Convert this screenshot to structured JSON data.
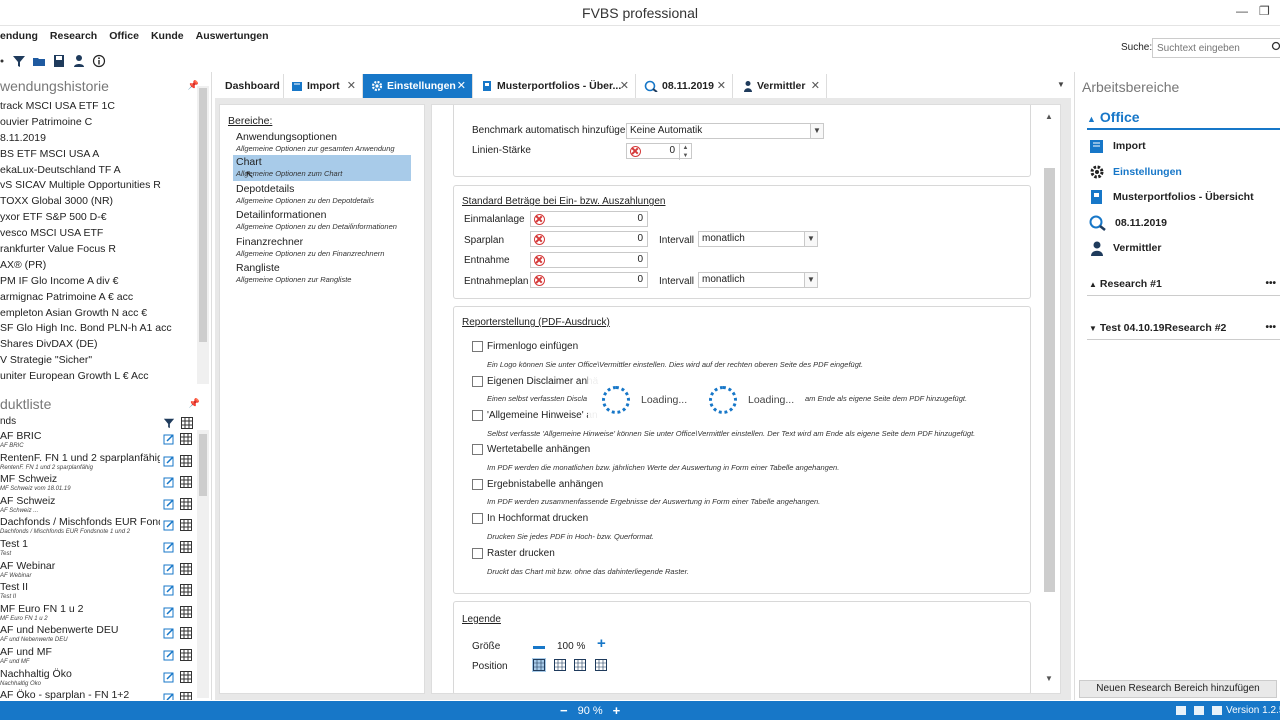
{
  "window": {
    "title": "FVBS professional"
  },
  "menu": [
    "endung",
    "Research",
    "Office",
    "Kunde",
    "Auswertungen"
  ],
  "search": {
    "label": "Suche:",
    "placeholder": "Suchtext eingeben"
  },
  "left": {
    "history_title": "wendungshistorie",
    "history": [
      "track MSCI USA ETF 1C",
      "ouvier Patrimoine C",
      "8.11.2019",
      "BS ETF MSCI USA A",
      "ekaLux-Deutschland TF A",
      "vS SICAV Multiple Opportunities R",
      "TOXX Global 3000 (NR)",
      "yxor ETF S&P 500 D-€",
      "vesco MSCI USA ETF",
      "rankfurter Value Focus R",
      "AX® (PR)",
      "PM IF Glo Income A div €",
      "armignac Patrimoine A € acc",
      "empleton Asian Growth N acc €",
      "SF Glo High Inc. Bond PLN-h A1 acc",
      "Shares DivDAX (DE)",
      "V Strategie \"Sicher\"",
      "uniter European Growth L € Acc"
    ],
    "products_title": "duktliste",
    "products_group": "nds",
    "products": [
      {
        "name": "AF BRIC",
        "sub": "AF BRIC"
      },
      {
        "name": "RentenF. FN 1 und 2 sparplanfähig",
        "sub": "RentenF. FN 1 und 2 sparplanfähig"
      },
      {
        "name": "MF Schweiz",
        "sub": "MF Schweiz vom 18.01.19"
      },
      {
        "name": "AF Schweiz",
        "sub": "AF Schweiz ..."
      },
      {
        "name": "Dachfonds / Mischfonds EUR Fondsn",
        "sub": "Dachfonds / Mischfonds EUR Fondsnote 1 und 2"
      },
      {
        "name": "Test 1",
        "sub": "Test"
      },
      {
        "name": "AF Webinar",
        "sub": "AF Webinar"
      },
      {
        "name": "Test II",
        "sub": "Test II"
      },
      {
        "name": "MF Euro FN 1 u 2",
        "sub": "MF Euro FN 1 u 2"
      },
      {
        "name": "AF und Nebenwerte DEU",
        "sub": "AF und Nebenwerte DEU"
      },
      {
        "name": "AF und MF",
        "sub": "AF und MF"
      },
      {
        "name": "Nachhaltig Öko",
        "sub": "Nachhaltig Öko"
      },
      {
        "name": "AF Öko - sparplan - FN 1+2",
        "sub": ""
      }
    ]
  },
  "tabs": [
    {
      "label": "Dashboard"
    },
    {
      "label": "Import"
    },
    {
      "label": "Einstellungen"
    },
    {
      "label": "Musterportfolios - Über..."
    },
    {
      "label": "08.11.2019"
    },
    {
      "label": "Vermittler"
    }
  ],
  "bereiche": {
    "title": "Bereiche:",
    "items": [
      {
        "name": "Anwendungsoptionen",
        "desc": "Allgemeine Optionen zur gesamten Anwendung"
      },
      {
        "name": "Chart",
        "desc": "Allgemeine Optionen zum Chart"
      },
      {
        "name": "Depotdetails",
        "desc": "Allgemeine Optionen zu den Depotdetails"
      },
      {
        "name": "Detailinformationen",
        "desc": "Allgemeine Optionen zu den Detailinformationen"
      },
      {
        "name": "Finanzrechner",
        "desc": "Allgemeine Optionen zu den Finanzrechnern"
      },
      {
        "name": "Rangliste",
        "desc": "Allgemeine Optionen zur Rangliste"
      }
    ]
  },
  "settings": {
    "benchmark_label": "Benchmark automatisch hinzufügen",
    "benchmark_value": "Keine Automatik",
    "line_label": "Linien-Stärke",
    "line_value": "0",
    "beitraege": {
      "title": "Standard Beträge bei Ein- bzw. Auszahlungen",
      "einmal_label": "Einmalanlage",
      "einmal_value": "0",
      "spar_label": "Sparplan",
      "spar_value": "0",
      "entnahme_label": "Entnahme",
      "entnahme_value": "0",
      "entplan_label": "Entnahmeplan",
      "entplan_value": "0",
      "intervall_label": "Intervall",
      "intervall_value": "monatlich"
    },
    "report": {
      "title": "Reporterstellung (PDF-Ausdruck)",
      "options": [
        {
          "label": "Firmenlogo einfügen",
          "desc": "Ein Logo können Sie unter Office\\Vermittler einstellen. Dies wird auf der rechten oberen Seite des PDF eingefügt."
        },
        {
          "label": "Eigenen Disclaimer anhä",
          "desc": "Einen selbst verfassten Discla",
          "desc2": "am Ende als eigene Seite dem PDF hinzugefügt."
        },
        {
          "label": "'Allgemeine Hinweise' an",
          "desc": "Selbst verfasste 'Allgemeine Hinweise' können Sie unter Office\\Vermittler einstellen. Der Text wird am Ende als eigene Seite dem PDF hinzugefügt."
        },
        {
          "label": "Wertetabelle anhängen",
          "desc": "Im PDF werden die monatlichen bzw. jährlichen Werte der Auswertung in Form einer Tabelle angehangen."
        },
        {
          "label": "Ergebnistabelle anhängen",
          "desc": "Im PDF werden zusammenfassende Ergebnisse der Auswertung in Form einer Tabelle angehangen."
        },
        {
          "label": "In Hochformat drucken",
          "desc": "Drucken Sie jedes PDF in Hoch- bzw. Querformat."
        },
        {
          "label": "Raster drucken",
          "desc": "Druckt das Chart mit bzw. ohne das dahinterliegende Raster."
        }
      ]
    },
    "legende": {
      "title": "Legende",
      "size_label": "Größe",
      "size_value": "100 %",
      "position_label": "Position"
    },
    "loading": "Loading..."
  },
  "right": {
    "title": "Arbeitsbereiche",
    "section": "Office",
    "items": [
      {
        "label": "Import"
      },
      {
        "label": "Einstellungen"
      },
      {
        "label": "Musterportfolios - Übersicht"
      },
      {
        "label": "08.11.2019"
      },
      {
        "label": "Vermittler"
      }
    ],
    "group1": "Research #1",
    "group2": "Test 04.10.19Research #2",
    "dots": "•••",
    "add_button": "Neuen Research Bereich hinzufügen"
  },
  "status": {
    "zoom": "90 %",
    "version": "Version 1.2.5"
  },
  "colors": {
    "accent": "#1777c8",
    "selection": "#a8cbe9",
    "error": "#d53a3a"
  }
}
